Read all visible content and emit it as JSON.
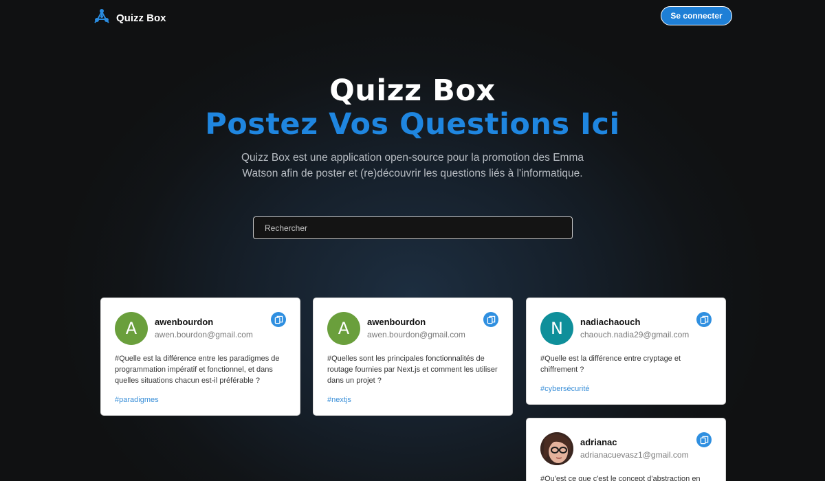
{
  "header": {
    "brand_name": "Quizz Box",
    "logo_icon": "network-nodes-icon",
    "connect_label": "Se connecter"
  },
  "hero": {
    "title": "Quizz Box",
    "subtitle": "Postez Vos Questions Ici",
    "description": "Quizz Box est une application open-source pour la promotion des Emma Watson afin de poster et (re)découvrir les questions liés à l'informatique."
  },
  "search": {
    "placeholder": "Rechercher"
  },
  "cards": [
    {
      "avatar_letter": "A",
      "avatar_color": "#6a9f3c",
      "username": "awenbourdon",
      "email": "awen.bourdon@gmail.com",
      "question": "#Quelle est la différence entre les paradigmes de programmation impératif et fonctionnel, et dans quelles situations chacun est-il préférable ?",
      "tag": "#paradigmes"
    },
    {
      "avatar_letter": "A",
      "avatar_color": "#6a9f3c",
      "username": "awenbourdon",
      "email": "awen.bourdon@gmail.com",
      "question": "#Quelles sont les principales fonctionnalités de routage fournies par Next.js et comment les utiliser dans un projet ?",
      "tag": "#nextjs"
    },
    {
      "avatar_letter": "N",
      "avatar_color": "#0f8f9a",
      "username": "nadiachaouch",
      "email": "chaouch.nadia29@gmail.com",
      "question": "#Quelle est la différence entre cryptage et chiffrement ?",
      "tag": "#cybersécurité"
    },
    {
      "avatar_letter": "",
      "username": "adrianac",
      "email": "adrianacuevasz1@gmail.com",
      "question": "#Qu'est ce que c'est le concept d'abstraction en"
    }
  ],
  "colors": {
    "accent": "#1f86e0",
    "button": "#1e7fd6",
    "tag": "#3a8fd8"
  }
}
